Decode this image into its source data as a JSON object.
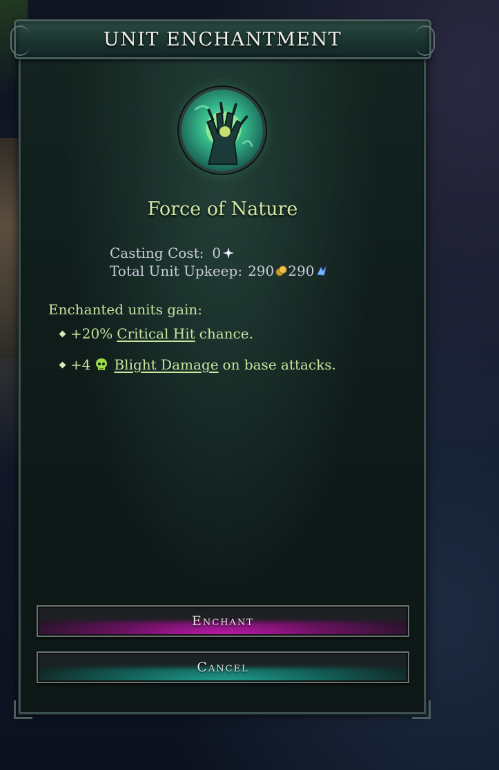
{
  "dialog": {
    "title": "UNIT ENCHANTMENT",
    "spell_icon": "force-of-nature-icon",
    "spell_name": "Force of Nature"
  },
  "costs": {
    "casting_label": "Casting Cost:",
    "casting_value": "0",
    "casting_icon": "mana-icon",
    "upkeep_label": "Total Unit Upkeep:",
    "upkeep_gold": "290",
    "upkeep_gold_icon": "gold-icon",
    "upkeep_mana": "290",
    "upkeep_mana_icon": "mana-crystal-icon"
  },
  "effects": {
    "heading": "Enchanted units gain:",
    "items": [
      {
        "prefix": "+20%",
        "link": "Critical Hit",
        "suffix": "chance."
      },
      {
        "prefix": "+4",
        "icon": "blight-skull-icon",
        "link": "Blight Damage",
        "suffix": "on base attacks."
      }
    ]
  },
  "buttons": {
    "enchant": "Enchant",
    "cancel": "Cancel"
  },
  "colors": {
    "accent_green": "#c9e6a0",
    "enchant_magenta": "#c21ab0",
    "cancel_teal": "#20a090",
    "frame": "#4a5f5e"
  }
}
